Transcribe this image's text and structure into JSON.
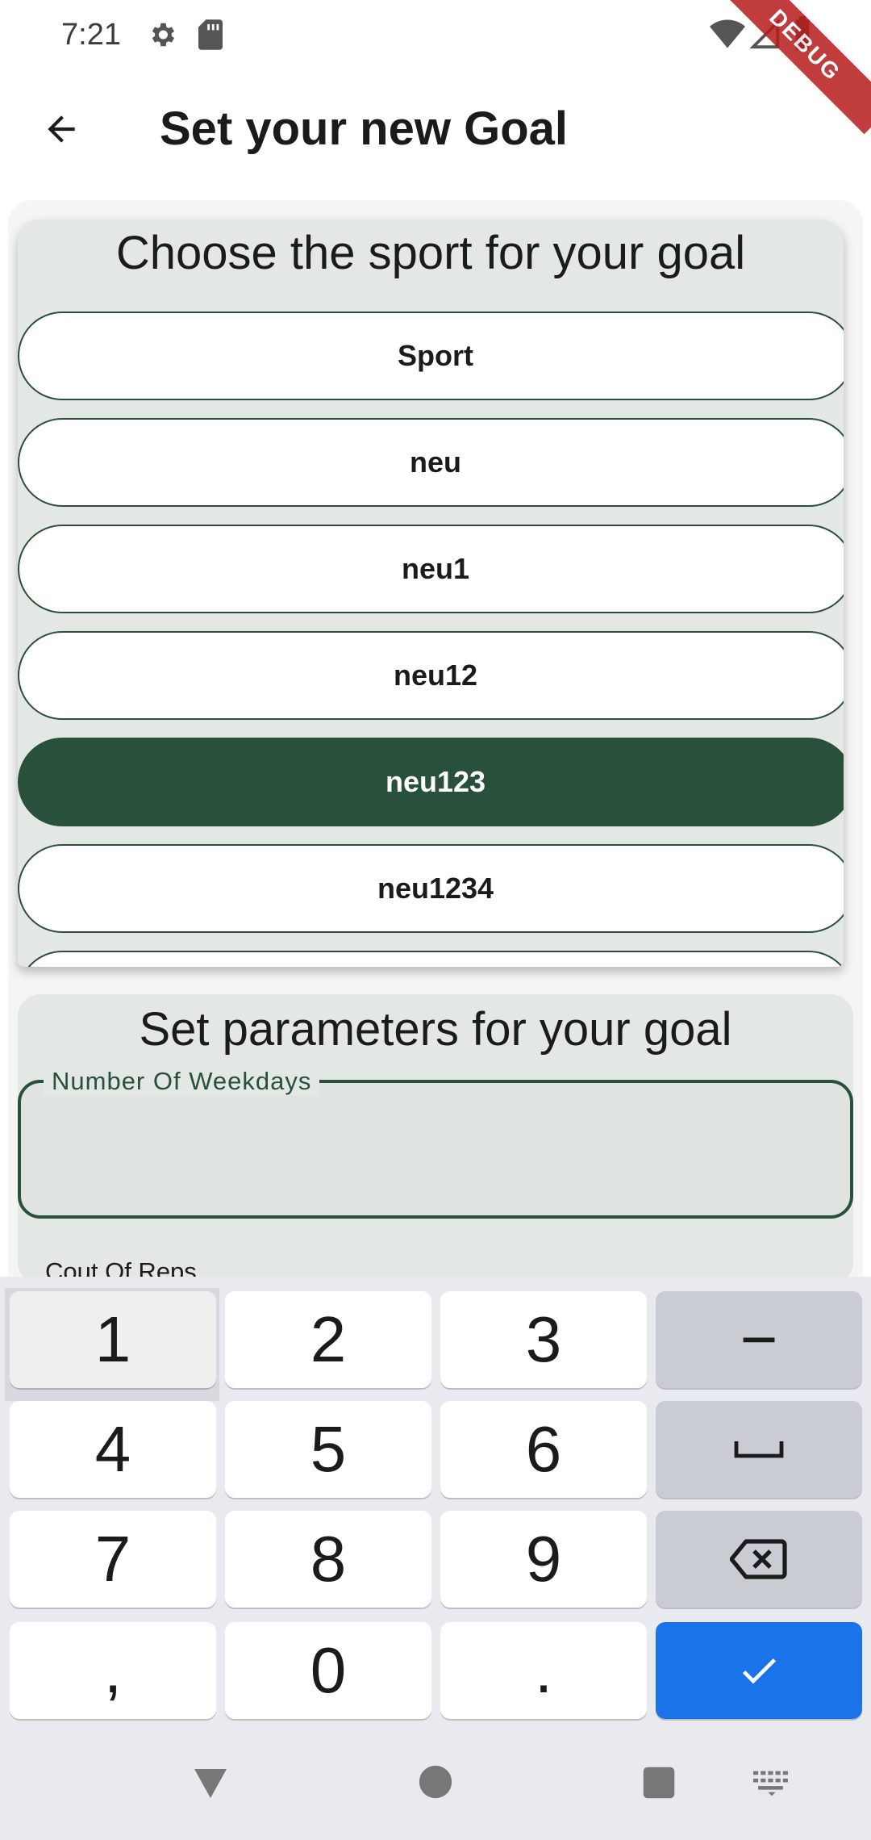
{
  "status_bar": {
    "time": "7:21",
    "icons": [
      "gear-icon",
      "sd-card-icon",
      "wifi-icon",
      "signal-icon",
      "battery-icon"
    ],
    "debug_banner": "DEBUG"
  },
  "app_bar": {
    "title": "Set your new Goal",
    "back_icon": "arrow-left-icon"
  },
  "sport_section": {
    "heading": "Choose the sport for your goal",
    "options": [
      {
        "label": "Sport",
        "selected": false
      },
      {
        "label": "neu",
        "selected": false
      },
      {
        "label": "neu1",
        "selected": false
      },
      {
        "label": "neu12",
        "selected": false
      },
      {
        "label": "neu123",
        "selected": true
      },
      {
        "label": "neu1234",
        "selected": false
      }
    ]
  },
  "params_section": {
    "heading": "Set parameters for your goal",
    "weekdays_field": {
      "label": "Number Of Weekdays",
      "value": ""
    },
    "reps_label": "Cout Of Reps"
  },
  "keyboard": {
    "keys": [
      [
        "1",
        "2",
        "3",
        "−"
      ],
      [
        "4",
        "5",
        "6",
        "space"
      ],
      [
        "7",
        "8",
        "9",
        "backspace"
      ],
      [
        ",",
        "0",
        ".",
        "done"
      ]
    ]
  },
  "colors": {
    "primary": "#28503a",
    "card": "#e3e8e4",
    "done_key": "#1a73e8"
  }
}
